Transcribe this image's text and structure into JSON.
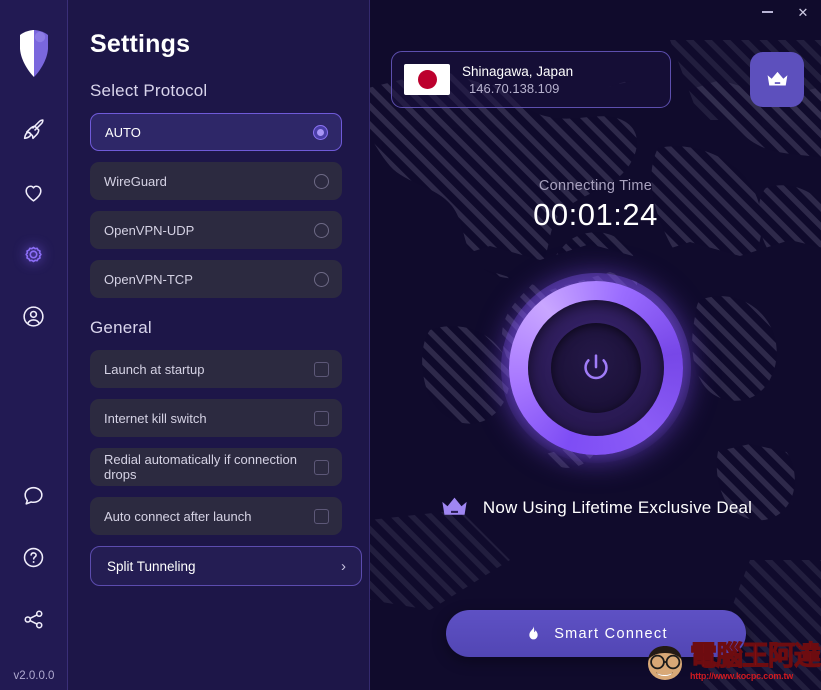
{
  "window": {
    "minimize_label": "minimize",
    "close_label": "✕"
  },
  "rail": {
    "logo_name": "app-logo",
    "items": [
      {
        "name": "rocket-icon",
        "label": "Boost",
        "active": false
      },
      {
        "name": "heart-icon",
        "label": "Favorites",
        "active": false
      },
      {
        "name": "gear-icon",
        "label": "Settings",
        "active": true
      },
      {
        "name": "account-icon",
        "label": "Account",
        "active": false
      }
    ],
    "bottom_items": [
      {
        "name": "chat-icon",
        "label": "Feedback"
      },
      {
        "name": "help-icon",
        "label": "Help"
      },
      {
        "name": "share-icon",
        "label": "Share"
      }
    ],
    "version": "v2.0.0.0"
  },
  "settings": {
    "title": "Settings",
    "protocol_section": "Select Protocol",
    "protocols": [
      {
        "label": "AUTO",
        "selected": true
      },
      {
        "label": "WireGuard",
        "selected": false
      },
      {
        "label": "OpenVPN-UDP",
        "selected": false
      },
      {
        "label": "OpenVPN-TCP",
        "selected": false
      }
    ],
    "general_section": "General",
    "general": [
      {
        "label": "Launch at startup",
        "checked": false
      },
      {
        "label": "Internet kill switch",
        "checked": false
      },
      {
        "label": "Redial automatically if connection drops",
        "checked": false
      },
      {
        "label": "Auto connect after launch",
        "checked": false
      }
    ],
    "split_tunneling": {
      "label": "Split Tunneling",
      "chevron": "›"
    }
  },
  "main": {
    "location": {
      "name": "Shinagawa, Japan",
      "ip": "146.70.138.109",
      "flag_name": "japan-flag"
    },
    "premium_button_label": "Premium",
    "connecting_label": "Connecting Time",
    "connecting_time": "00:01:24",
    "power_button_label": "Disconnect",
    "deal_text": "Now Using Lifetime Exclusive Deal",
    "smart_connect_label": "Smart Connect"
  },
  "watermark": {
    "text": "電腦王阿達",
    "url": "http://www.kocpc.com.tw"
  },
  "colors": {
    "accent": "#7b5cf0",
    "panel": "#1d1648",
    "rail": "#221a53",
    "main_bg": "#100b2c",
    "row": "#2c2a40",
    "row_selected": "#2e2768",
    "button": "#5d50bd",
    "flag_red": "#bc002d"
  }
}
